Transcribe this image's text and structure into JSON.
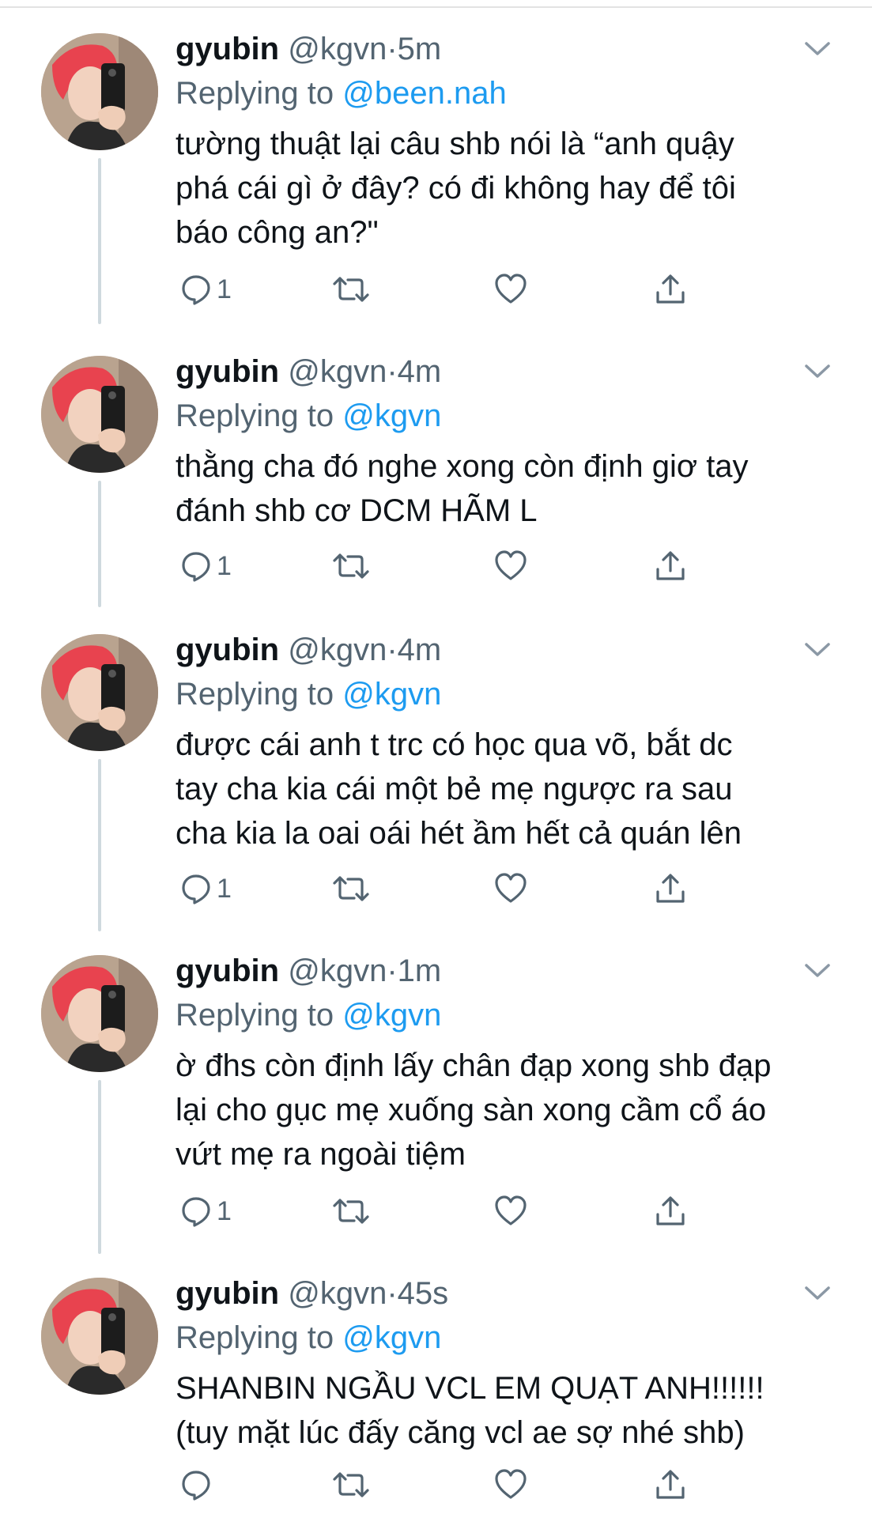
{
  "tweets": [
    {
      "name": "gyubin",
      "handle": "@kgvn",
      "separator": "·",
      "time": "5m",
      "replying_prefix": "Replying to",
      "replying_to": "@been.nah",
      "body_lines": [
        "tường thuật lại câu shb nói là “anh quậy",
        "phá cái gì ở đây? có đi không hay để tôi",
        "báo công an?\""
      ],
      "reply_count": "1",
      "icons": [
        "avatar",
        "chevron-down-icon",
        "reply-icon",
        "retweet-icon",
        "like-icon",
        "share-icon"
      ]
    },
    {
      "name": "gyubin",
      "handle": "@kgvn",
      "separator": "·",
      "time": "4m",
      "replying_prefix": "Replying to",
      "replying_to": "@kgvn",
      "body_lines": [
        "thằng cha đó nghe xong còn định giơ tay",
        "đánh shb cơ DCM HÃM L"
      ],
      "reply_count": "1"
    },
    {
      "name": "gyubin",
      "handle": "@kgvn",
      "separator": "·",
      "time": "4m",
      "replying_prefix": "Replying to",
      "replying_to": "@kgvn",
      "body_lines": [
        "được cái anh t trc có học qua võ, bắt dc",
        "tay cha kia cái một bẻ mẹ ngược ra sau",
        "cha kia la oai oái hét ầm hết cả quán lên"
      ],
      "reply_count": "1"
    },
    {
      "name": "gyubin",
      "handle": "@kgvn",
      "separator": "·",
      "time": "1m",
      "replying_prefix": "Replying to",
      "replying_to": "@kgvn",
      "body_lines": [
        "ờ đhs còn định lấy chân đạp xong shb đạp",
        "lại cho gục mẹ xuống sàn xong cầm cổ áo",
        "vứt mẹ ra ngoài tiệm"
      ],
      "reply_count": "1"
    },
    {
      "name": "gyubin",
      "handle": "@kgvn",
      "separator": "·",
      "time": "45s",
      "replying_prefix": "Replying to",
      "replying_to": "@kgvn",
      "body_lines": [
        "SHANBIN NGẦU VCL EM QUẠT ANH!!!!!!",
        "(tuy mặt lúc đấy căng vcl ae sợ nhé shb)"
      ],
      "reply_count": ""
    }
  ],
  "colors": {
    "text": "#0f1419",
    "secondary": "#536471",
    "mention": "#1d9bf0",
    "thread_line": "#cfd9de",
    "avatar_hair": "#e8434f"
  }
}
